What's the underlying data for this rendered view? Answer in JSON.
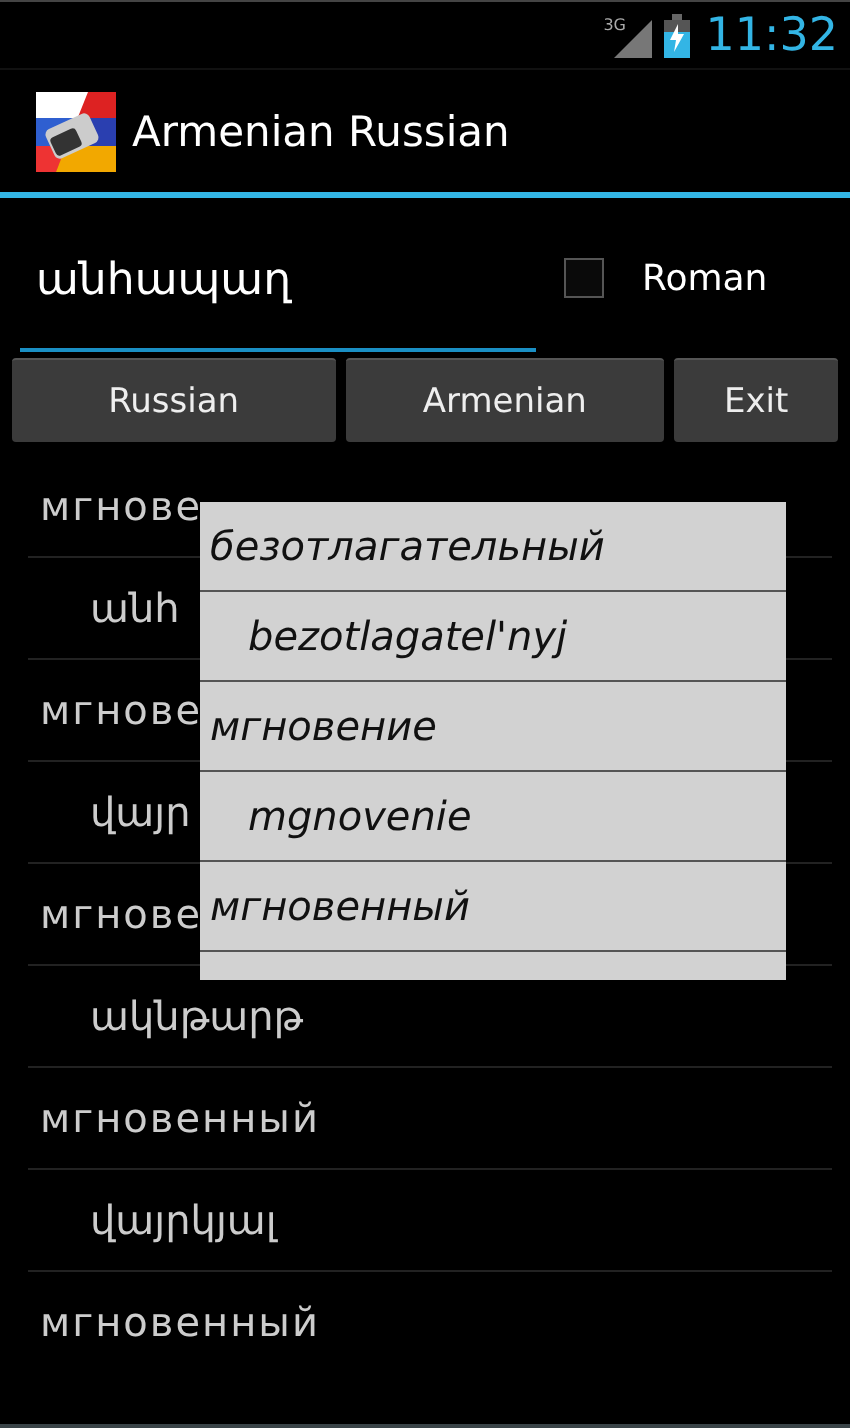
{
  "status_bar": {
    "network": "3G",
    "time": "11:32"
  },
  "action_bar": {
    "title": "Armenian Russian"
  },
  "search": {
    "value": "անհապաղ"
  },
  "roman": {
    "label": "Roman",
    "checked": false
  },
  "buttons": [
    "Russian",
    "Armenian",
    "Exit"
  ],
  "results": [
    {
      "text": "мгнове",
      "kind": "word"
    },
    {
      "text": "անհ",
      "kind": "translation"
    },
    {
      "text": "мгнове",
      "kind": "word"
    },
    {
      "text": "վայր",
      "kind": "translation"
    },
    {
      "text": "мгнове",
      "kind": "word"
    },
    {
      "text": "ակնթարթ",
      "kind": "translation"
    },
    {
      "text": "мгновенный",
      "kind": "word"
    },
    {
      "text": "վայրկյալ",
      "kind": "translation"
    },
    {
      "text": "мгновенный",
      "kind": "word"
    }
  ],
  "popup": {
    "items": [
      {
        "text": "безотлагательный",
        "kind": "word"
      },
      {
        "text": "bezotlagatel'nyj",
        "kind": "roman"
      },
      {
        "text": "мгновение",
        "kind": "word"
      },
      {
        "text": "mgnovenie",
        "kind": "roman"
      },
      {
        "text": "мгновенный",
        "kind": "word"
      }
    ]
  }
}
